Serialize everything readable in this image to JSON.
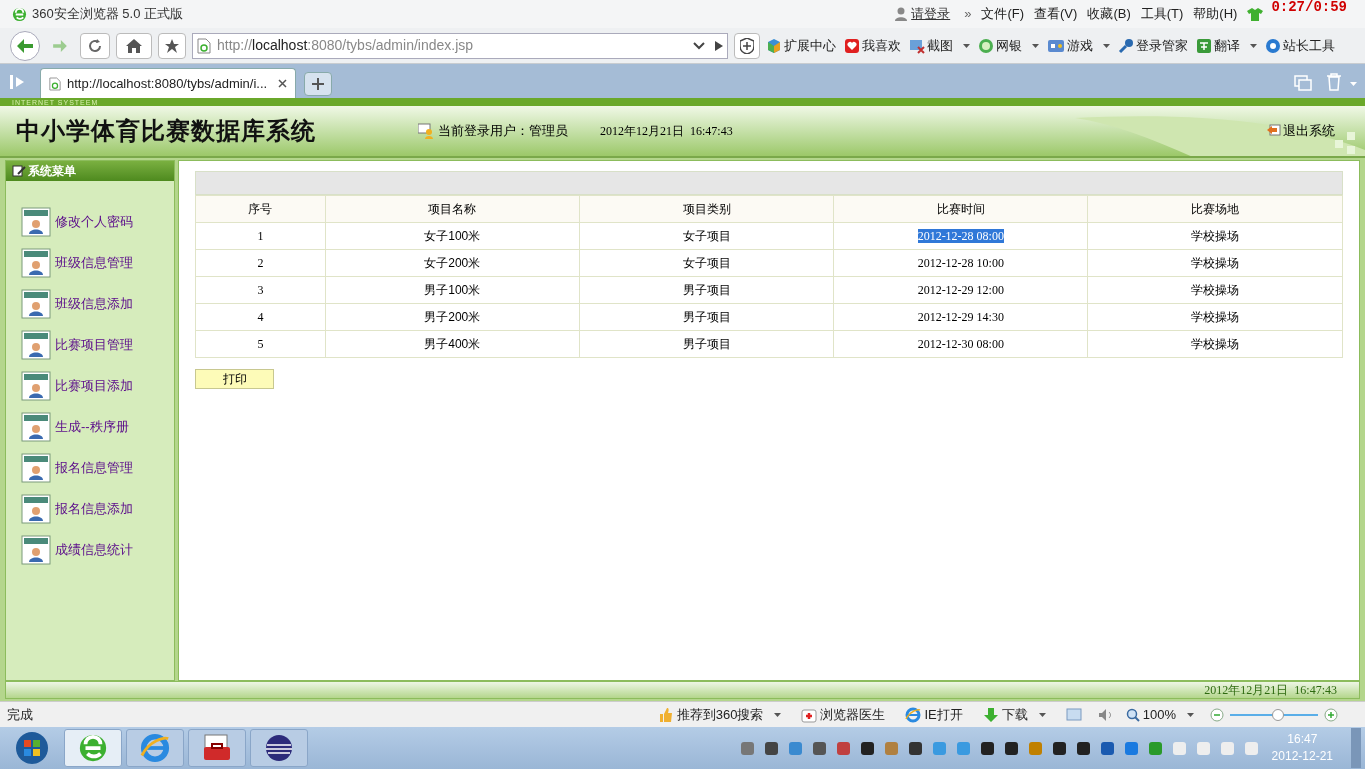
{
  "browser": {
    "title": "360安全浏览器 5.0 正式版",
    "login": "请登录",
    "more": "»",
    "menus": [
      "文件(F)",
      "查看(V)",
      "收藏(B)",
      "工具(T)",
      "帮助(H)"
    ],
    "timer": "0:27/0:59",
    "address": {
      "prefix": "http://",
      "host": "localhost",
      "rest": ":8080/tybs/admin/index.jsp"
    },
    "toolbar": [
      {
        "label": "扩展中心",
        "kind": "cube",
        "dropdown": false
      },
      {
        "label": "我喜欢",
        "kind": "heart",
        "dropdown": false
      },
      {
        "label": "截图",
        "kind": "scissors",
        "dropdown": true
      },
      {
        "label": "网银",
        "kind": "bank",
        "dropdown": true
      },
      {
        "label": "游戏",
        "kind": "game",
        "dropdown": true
      },
      {
        "label": "登录管家",
        "kind": "key",
        "dropdown": false
      },
      {
        "label": "翻译",
        "kind": "translate",
        "dropdown": true
      },
      {
        "label": "站长工具",
        "kind": "tools",
        "dropdown": false
      }
    ],
    "tabs": [
      {
        "label": "http://localhost:8080/tybs/admin/i...",
        "selected": true
      }
    ]
  },
  "page": {
    "banner_tag": "INTERNET SYSTEEM",
    "title": "中小学体育比赛数据库系统",
    "user_label": "当前登录用户：管理员",
    "datetime": "2012年12月21日  16:47:43",
    "logout": "退出系统",
    "menu_title": "系统菜单",
    "menu": [
      "修改个人密码",
      "班级信息管理",
      "班级信息添加",
      "比赛项目管理",
      "比赛项目添加",
      "生成--秩序册",
      "报名信息管理",
      "报名信息添加",
      "成绩信息统计"
    ],
    "table": {
      "columns": [
        "序号",
        "项目名称",
        "项目类别",
        "比赛时间",
        "比赛场地"
      ],
      "rows": [
        {
          "cells": [
            "1",
            "女子100米",
            "女子项目",
            "2012-12-28 08:00",
            "学校操场"
          ],
          "time_selected": true
        },
        {
          "cells": [
            "2",
            "女子200米",
            "女子项目",
            "2012-12-28 10:00",
            "学校操场"
          ],
          "time_selected": false
        },
        {
          "cells": [
            "3",
            "男子100米",
            "男子项目",
            "2012-12-29 12:00",
            "学校操场"
          ],
          "time_selected": false
        },
        {
          "cells": [
            "4",
            "男子200米",
            "男子项目",
            "2012-12-29 14:30",
            "学校操场"
          ],
          "time_selected": false
        },
        {
          "cells": [
            "5",
            "男子400米",
            "男子项目",
            "2012-12-30 08:00",
            "学校操场"
          ],
          "time_selected": false
        }
      ]
    },
    "print_button": "打印",
    "footer_datetime": "2012年12月21日  16:47:43"
  },
  "status_bar": {
    "text": "完成",
    "items": [
      {
        "label": "推荐到360搜索",
        "kind": "thumb",
        "dropdown": true
      },
      {
        "label": "浏览器医生",
        "kind": "kit",
        "dropdown": false
      },
      {
        "label": "IE打开",
        "kind": "ie",
        "dropdown": false
      },
      {
        "label": "下载",
        "kind": "download",
        "dropdown": true
      }
    ],
    "zoom": "100%",
    "level": 0.55
  },
  "taskbar": {
    "time": "16:47",
    "date": "2012-12-21"
  }
}
